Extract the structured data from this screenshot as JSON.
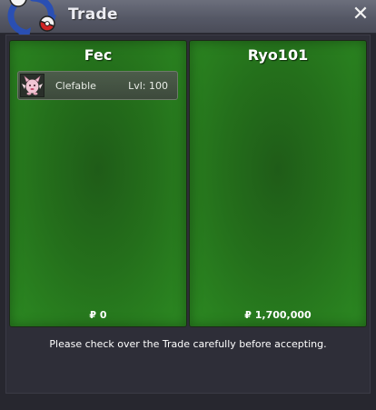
{
  "window": {
    "title": "Trade",
    "close_glyph": "✕"
  },
  "icons": {
    "logo": "trade-arrows-pokeball-icon",
    "close": "close-icon"
  },
  "colors": {
    "panel_green": "#246f1b",
    "titlebar": "#5a5d6b",
    "background": "#27272f"
  },
  "left_panel": {
    "player": "Fec",
    "money": "₽ 0",
    "items": [
      {
        "name": "Clefable",
        "level": "Lvl: 100",
        "sprite": "clefable-sprite-icon"
      }
    ]
  },
  "right_panel": {
    "player": "Ryo101",
    "money": "₽ 1,700,000",
    "items": []
  },
  "footer": {
    "note": "Please check over the Trade carefully before accepting."
  }
}
